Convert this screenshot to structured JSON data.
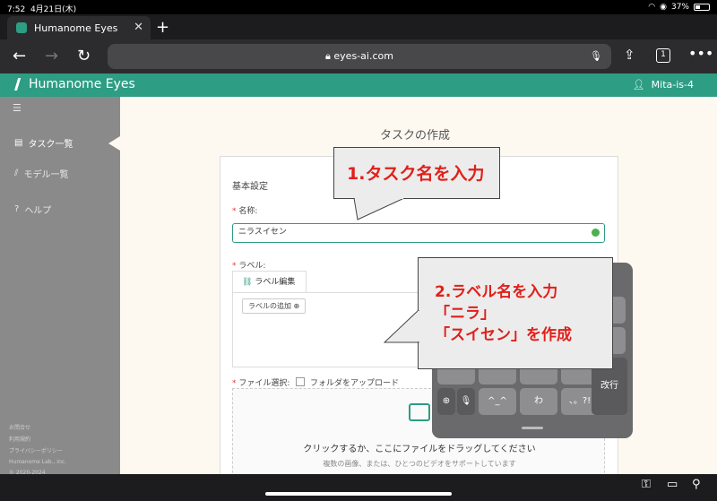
{
  "status": {
    "time": "7:52",
    "date": "4月21日(木)",
    "battery": "37%",
    "battery_level": 0.37
  },
  "browser": {
    "tab_title": "Humanome Eyes",
    "url": "eyes-ai.com",
    "tab_count": "1"
  },
  "app": {
    "brand": "Humanome Eyes",
    "user": "Mita-is-4"
  },
  "sidebar": {
    "items": [
      {
        "label": "タスク一覧"
      },
      {
        "label": "モデル一覧"
      },
      {
        "label": "ヘルプ"
      }
    ],
    "footer": [
      "お問合せ",
      "利用規約",
      "プライバシーポリシー",
      "Humanome Lab., Inc.",
      "© 2020-2024"
    ]
  },
  "page": {
    "title": "タスクの作成",
    "section": "基本設定",
    "name_label": "名称:",
    "name_value": "ニラスイセン",
    "label_label": "ラベル:",
    "label_tab": "ラベル編集",
    "add_label": "ラベルの追加",
    "file_label": "ファイル選択:",
    "folder_upload": "フォルダをアップロード",
    "drop_text": "クリックするか、ここにファイルをドラッグしてください",
    "drop_sub": "複数の画像、または、ひとつのビデオをサポートしています"
  },
  "callouts": {
    "one": "1.タスク名を入力",
    "two_line1": "2.ラベル名を入力",
    "two_line2": "「ニラ」",
    "two_line3": "「スイセン」を作成"
  },
  "keyboard": {
    "keys_row3": [
      "わ",
      "、。?!"
    ],
    "kaomoji": "^_^",
    "enter": "改行"
  }
}
